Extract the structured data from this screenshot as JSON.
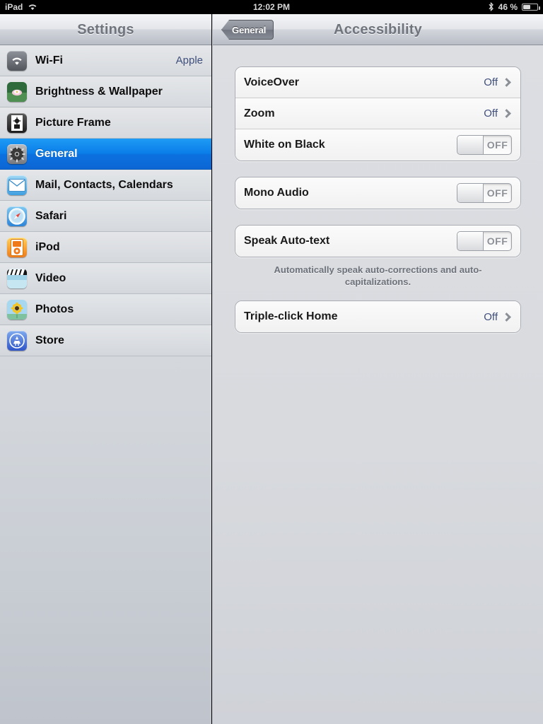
{
  "status_bar": {
    "carrier": "iPad",
    "wifi_icon": "wifi-icon",
    "time": "12:02 PM",
    "bluetooth_icon": "bluetooth-icon",
    "battery_percent": "46 %",
    "battery_level": 46
  },
  "sidebar": {
    "title": "Settings",
    "items": [
      {
        "label": "Wi-Fi",
        "value": "Apple",
        "icon": "wifi-settings-icon",
        "selected": false
      },
      {
        "label": "Brightness & Wallpaper",
        "value": "",
        "icon": "brightness-wallpaper-icon",
        "selected": false
      },
      {
        "label": "Picture Frame",
        "value": "",
        "icon": "picture-frame-icon",
        "selected": false
      },
      {
        "label": "General",
        "value": "",
        "icon": "general-gear-icon",
        "selected": true
      },
      {
        "label": "Mail, Contacts, Calendars",
        "value": "",
        "icon": "mail-icon",
        "selected": false
      },
      {
        "label": "Safari",
        "value": "",
        "icon": "safari-compass-icon",
        "selected": false
      },
      {
        "label": "iPod",
        "value": "",
        "icon": "ipod-icon",
        "selected": false
      },
      {
        "label": "Video",
        "value": "",
        "icon": "video-clapper-icon",
        "selected": false
      },
      {
        "label": "Photos",
        "value": "",
        "icon": "photos-sunflower-icon",
        "selected": false
      },
      {
        "label": "Store",
        "value": "",
        "icon": "app-store-icon",
        "selected": false
      }
    ]
  },
  "detail": {
    "back_button": "General",
    "title": "Accessibility",
    "groups": [
      {
        "rows": [
          {
            "label": "VoiceOver",
            "type": "disclosure",
            "value": "Off"
          },
          {
            "label": "Zoom",
            "type": "disclosure",
            "value": "Off"
          },
          {
            "label": "White on Black",
            "type": "toggle",
            "value": "OFF",
            "on": false
          }
        ],
        "footer": ""
      },
      {
        "rows": [
          {
            "label": "Mono Audio",
            "type": "toggle",
            "value": "OFF",
            "on": false
          }
        ],
        "footer": ""
      },
      {
        "rows": [
          {
            "label": "Speak Auto-text",
            "type": "toggle",
            "value": "OFF",
            "on": false
          }
        ],
        "footer": "Automatically speak auto-corrections and auto-capitalizations."
      },
      {
        "rows": [
          {
            "label": "Triple-click Home",
            "type": "disclosure",
            "value": "Off"
          }
        ],
        "footer": ""
      }
    ]
  },
  "colors": {
    "selection_blue": "#0a7de8",
    "value_blue": "#3f4f7c",
    "title_gray": "#70747d",
    "panel_bg": "#d8dade"
  }
}
